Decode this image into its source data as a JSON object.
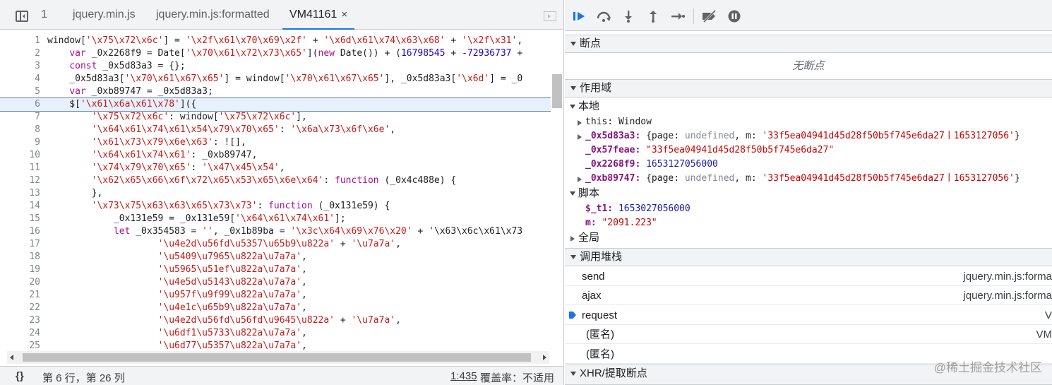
{
  "tabs": {
    "count": "1",
    "items": [
      "jquery.min.js",
      "jquery.min.js:formatted",
      "VM41161"
    ],
    "close": "×"
  },
  "editor": {
    "lines": [
      {
        "n": "1",
        "t": "window['\\x75\\x72\\x6c'] = '\\x2f\\x61\\x70\\x69\\x2f' + '\\x6d\\x61\\x74\\x63\\x68' + '\\x2f\\x31',"
      },
      {
        "n": "2",
        "t": "    var _0x2268f9 = Date['\\x70\\x61\\x72\\x73\\x65'](new Date()) + (16798545 + -72936737 +"
      },
      {
        "n": "3",
        "t": "    const _0x5d83a3 = {};"
      },
      {
        "n": "4",
        "t": "    _0x5d83a3['\\x70\\x61\\x67\\x65'] = window['\\x70\\x61\\x67\\x65'], _0x5d83a3['\\x6d'] = _0"
      },
      {
        "n": "5",
        "t": "    var _0xb89747 = _0x5d83a3;"
      },
      {
        "n": "6",
        "t": "    $['\\x61\\x6a\\x61\\x78']({"
      },
      {
        "n": "7",
        "t": "        '\\x75\\x72\\x6c': window['\\x75\\x72\\x6c'],"
      },
      {
        "n": "8",
        "t": "        '\\x64\\x61\\x74\\x61\\x54\\x79\\x70\\x65': '\\x6a\\x73\\x6f\\x6e',"
      },
      {
        "n": "9",
        "t": "        '\\x61\\x73\\x79\\x6e\\x63': ![],"
      },
      {
        "n": "10",
        "t": "        '\\x64\\x61\\x74\\x61': _0xb89747,"
      },
      {
        "n": "11",
        "t": "        '\\x74\\x79\\x70\\x65': '\\x47\\x45\\x54',"
      },
      {
        "n": "12",
        "t": "        '\\x62\\x65\\x66\\x6f\\x72\\x65\\x53\\x65\\x6e\\x64': function (_0x4c488e) {"
      },
      {
        "n": "13",
        "t": "        },"
      },
      {
        "n": "14",
        "t": "        '\\x73\\x75\\x63\\x63\\x65\\x73\\x73': function (_0x131e59) {"
      },
      {
        "n": "15",
        "t": "            _0x131e59 = _0x131e59['\\x64\\x61\\x74\\x61'];"
      },
      {
        "n": "16",
        "t": "            let _0x354583 = '', _0x1b89ba = '\\x3c\\x64\\x69\\x76\\x20' + '\\x63\\x6c\\x61\\x73"
      },
      {
        "n": "17",
        "t": "                    '\\u4e2d\\u56fd\\u5357\\u65b9\\u822a' + '\\u7a7a',"
      },
      {
        "n": "18",
        "t": "                    '\\u5409\\u7965\\u822a\\u7a7a',"
      },
      {
        "n": "19",
        "t": "                    '\\u5965\\u51ef\\u822a\\u7a7a',"
      },
      {
        "n": "20",
        "t": "                    '\\u4e5d\\u5143\\u822a\\u7a7a',"
      },
      {
        "n": "21",
        "t": "                    '\\u957f\\u9f99\\u822a\\u7a7a',"
      },
      {
        "n": "22",
        "t": "                    '\\u4e1c\\u65b9\\u822a\\u7a7a',"
      },
      {
        "n": "23",
        "t": "                    '\\u4e2d\\u56fd\\u56fd\\u9645\\u822a' + '\\u7a7a',"
      },
      {
        "n": "24",
        "t": "                    '\\u6df1\\u5733\\u822a\\u7a7a',"
      },
      {
        "n": "25",
        "t": "                    '\\u6d77\\u5357\\u822a\\u7a7a',"
      }
    ]
  },
  "status": {
    "braces": "{}",
    "position": "第 6 行，第 26 列",
    "link": "1:435",
    "coverage": "覆盖率：不适用"
  },
  "sections": {
    "breakpoints": "断点",
    "no_breakpoints": "无断点",
    "scope": "作用域",
    "local": "本地",
    "script": "脚本",
    "global": "全局",
    "callstack": "调用堆栈",
    "xhr": "XHR/提取断点"
  },
  "scope": {
    "this_key": "this:",
    "this_val": "Window",
    "v1_key": "_0x5d83a3:",
    "v1_val_a": "{page: ",
    "v1_val_b": "undefined",
    "v1_val_c": ", m: ",
    "v1_val_d": "'33f5ea04941d45d28f50b5f745e6da27丨1653127056'",
    "v1_val_e": "}",
    "v2_key": "_0x57feae:",
    "v2_val": "\"33f5ea04941d45d28f50b5f745e6da27\"",
    "v3_key": "_0x2268f9:",
    "v3_val": "1653127056000",
    "v4_key": "_0xb89747:",
    "v4_val_a": "{page: ",
    "v4_val_b": "undefined",
    "v4_val_c": ", m: ",
    "v4_val_d": "'33f5ea04941d45d28f50b5f745e6da27丨1653127056'",
    "v4_val_e": "}",
    "s1_key": "$_t1:",
    "s1_val": "1653027056000",
    "s2_key": "m:",
    "s2_val": "\"2091.223\""
  },
  "callstack": [
    {
      "fn": "send",
      "loc": "jquery.min.js:forma"
    },
    {
      "fn": "ajax",
      "loc": "jquery.min.js:forma"
    },
    {
      "fn": "request",
      "loc": "V"
    },
    {
      "fn": "(匿名)",
      "loc": "VM"
    },
    {
      "fn": "(匿名)",
      "loc": ""
    }
  ],
  "watermark": "@稀土掘金技术社区"
}
